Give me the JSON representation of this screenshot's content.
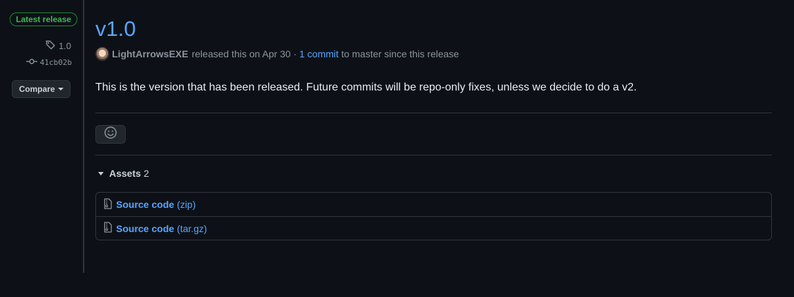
{
  "sidebar": {
    "latest_badge": "Latest release",
    "tag": {
      "icon": "tag-icon",
      "label": "1.0"
    },
    "commit": {
      "icon": "git-commit-icon",
      "sha": "41cb02b"
    },
    "compare_label": "Compare"
  },
  "release": {
    "title": "v1.0",
    "author": "LightArrowsEXE",
    "released_text": "released this on Apr 30 ·",
    "commits_link": "1 commit",
    "commits_suffix": "to master since this release",
    "body": "This is the version that has been released. Future commits will be repo-only fixes, unless we decide to do a v2."
  },
  "reactions": {
    "icon": "smiley-icon"
  },
  "assets": {
    "label": "Assets",
    "count": "2",
    "items": [
      {
        "icon": "file-zip-icon",
        "name": "Source code",
        "ext": "(zip)"
      },
      {
        "icon": "file-zip-icon",
        "name": "Source code",
        "ext": "(tar.gz)"
      }
    ]
  },
  "colors": {
    "background": "#0d1117",
    "link": "#58a6ff",
    "badge_green": "#3fb950",
    "border": "#30363d"
  }
}
